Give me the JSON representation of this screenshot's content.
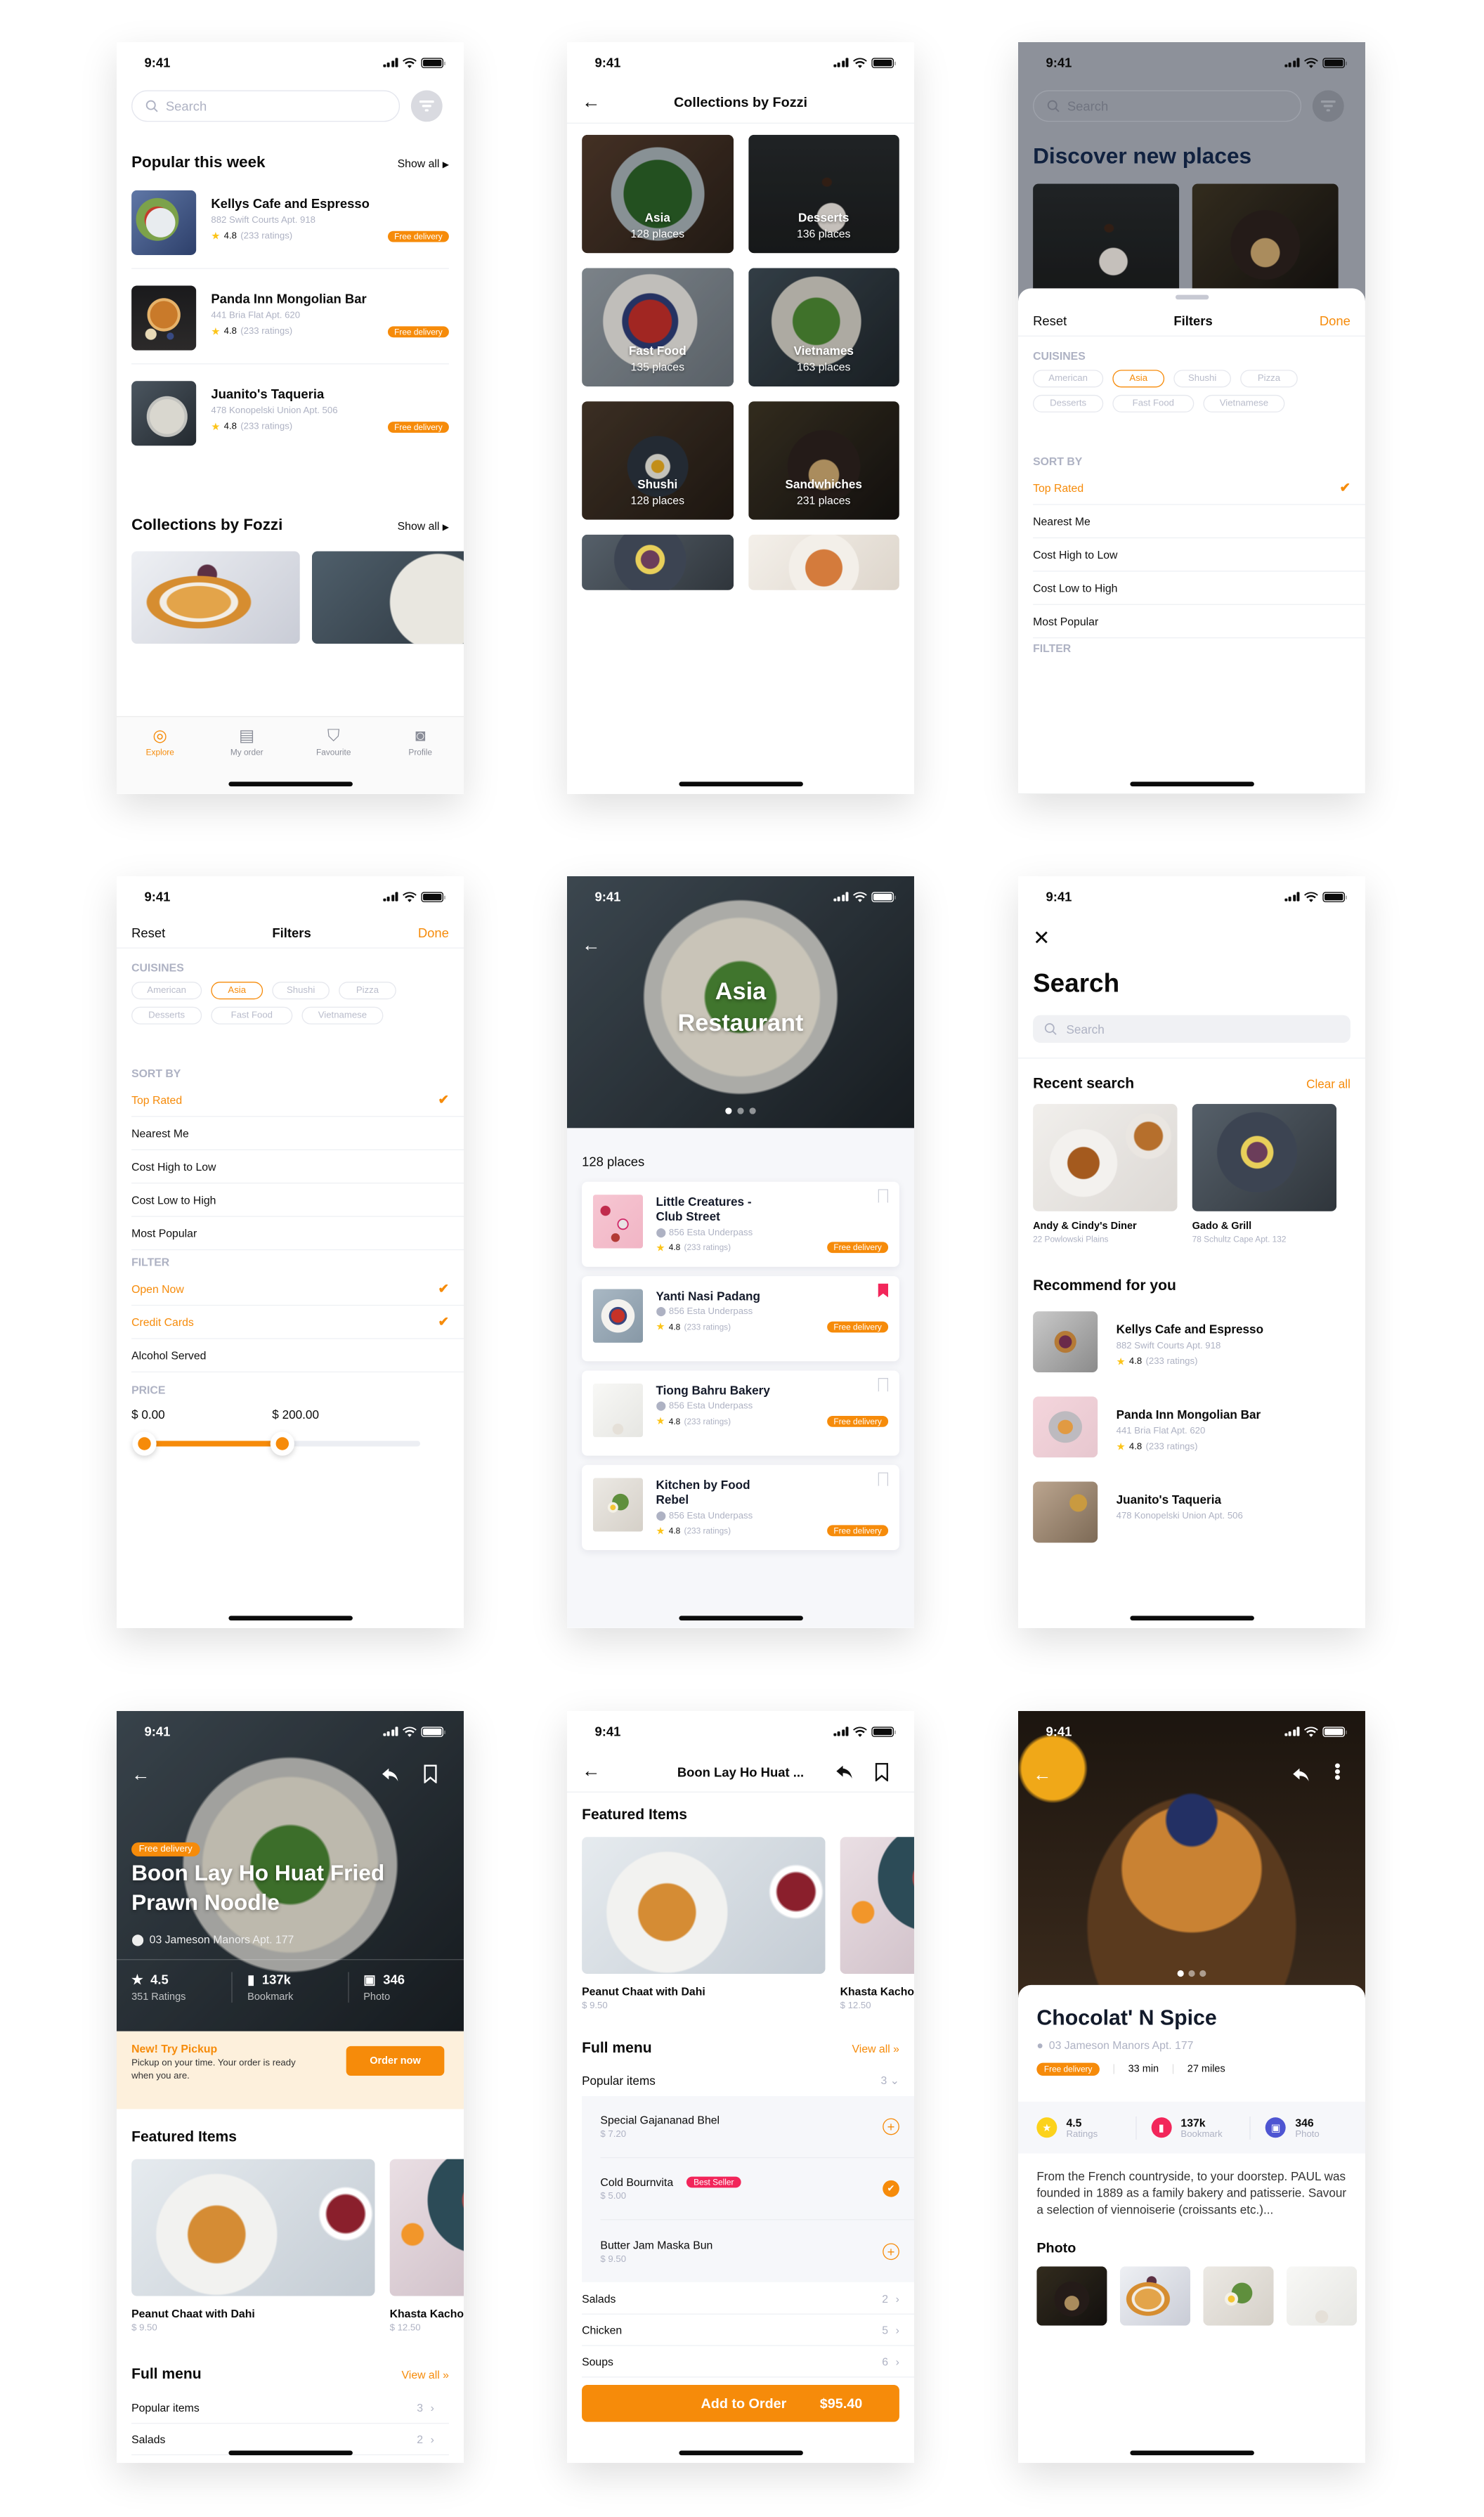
{
  "status_time": "9:41",
  "colors": {
    "accent": "#f68b0a",
    "text": "#0b0b0b",
    "muted": "#aeb2c3",
    "red": "#f2265a",
    "yellow": "#fcd21b",
    "indigo": "#4e55d2",
    "peach": "#fdf0dc"
  },
  "screen_home": {
    "search_placeholder": "Search",
    "popular_title": "Popular this week",
    "show_all": "Show all",
    "restaurants": [
      {
        "name": "Kellys Cafe and Espresso",
        "address": "882 Swift Courts Apt. 918",
        "rating": "4.8",
        "ratings_count": "(233 ratings)",
        "badge": "Free delivery"
      },
      {
        "name": "Panda Inn Mongolian Bar",
        "address": "441 Bria Flat Apt. 620",
        "rating": "4.8",
        "ratings_count": "(233 ratings)",
        "badge": "Free delivery"
      },
      {
        "name": "Juanito's Taqueria",
        "address": "478 Konopelski Union Apt. 506",
        "rating": "4.8",
        "ratings_count": "(233 ratings)",
        "badge": "Free delivery"
      }
    ],
    "collections_title": "Collections by Fozzi",
    "collections_show_all": "Show all",
    "tabs": [
      {
        "label": "Explore",
        "icon": "compass-icon",
        "active": true
      },
      {
        "label": "My order",
        "icon": "order-icon",
        "active": false
      },
      {
        "label": "Favourite",
        "icon": "bookmark-icon",
        "active": false
      },
      {
        "label": "Profile",
        "icon": "profile-icon",
        "active": false
      }
    ]
  },
  "screen_collections": {
    "title": "Collections by Fozzi",
    "items": [
      {
        "name": "Asia",
        "count": "128 places"
      },
      {
        "name": "Desserts",
        "count": "136 places"
      },
      {
        "name": "Fast Food",
        "count": "135 places"
      },
      {
        "name": "Vietnames",
        "count": "163 places"
      },
      {
        "name": "Shushi",
        "count": "128 places"
      },
      {
        "name": "Sandwhiches",
        "count": "231 places"
      }
    ]
  },
  "screen_filter_sheet": {
    "search_placeholder": "Search",
    "discover_title": "Discover new places",
    "reset": "Reset",
    "title": "Filters",
    "done": "Done",
    "cuisines_label": "CUISINES",
    "cuisines": [
      {
        "label": "American",
        "selected": false
      },
      {
        "label": "Asia",
        "selected": true
      },
      {
        "label": "Shushi",
        "selected": false
      },
      {
        "label": "Pizza",
        "selected": false
      },
      {
        "label": "Desserts",
        "selected": false
      },
      {
        "label": "Fast Food",
        "selected": false
      },
      {
        "label": "Vietnamese",
        "selected": false
      }
    ],
    "sort_label": "SORT BY",
    "sort_options": [
      {
        "label": "Top Rated",
        "selected": true
      },
      {
        "label": "Nearest Me",
        "selected": false
      },
      {
        "label": "Cost High to Low",
        "selected": false
      },
      {
        "label": "Cost Low to High",
        "selected": false
      },
      {
        "label": "Most Popular",
        "selected": false
      }
    ],
    "filter_label": "FILTER"
  },
  "screen_filters": {
    "reset": "Reset",
    "title": "Filters",
    "done": "Done",
    "cuisines_label": "CUISINES",
    "cuisines": [
      {
        "label": "American",
        "selected": false
      },
      {
        "label": "Asia",
        "selected": true
      },
      {
        "label": "Shushi",
        "selected": false
      },
      {
        "label": "Pizza",
        "selected": false
      },
      {
        "label": "Desserts",
        "selected": false
      },
      {
        "label": "Fast Food",
        "selected": false
      },
      {
        "label": "Vietnamese",
        "selected": false
      }
    ],
    "sort_label": "SORT BY",
    "sort_options": [
      {
        "label": "Top Rated",
        "selected": true
      },
      {
        "label": "Nearest Me",
        "selected": false
      },
      {
        "label": "Cost High to Low",
        "selected": false
      },
      {
        "label": "Cost Low to High",
        "selected": false
      },
      {
        "label": "Most Popular",
        "selected": false
      }
    ],
    "filter_label": "FILTER",
    "filter_options": [
      {
        "label": "Open Now",
        "selected": true
      },
      {
        "label": "Credit Cards",
        "selected": true
      },
      {
        "label": "Alcohol Served",
        "selected": false
      }
    ],
    "price_label": "PRICE",
    "price_min": "$ 0.00",
    "price_max": "$ 200.00",
    "price_range_fraction": [
      0,
      0.5
    ]
  },
  "screen_asia": {
    "hero_title_line1": "Asia",
    "hero_title_line2": "Restaurant",
    "carousel_pages": 3,
    "carousel_active": 1,
    "places_count": "128 places",
    "places": [
      {
        "name": "Little Creatures - Club Street",
        "address": "856 Esta Underpass",
        "rating": "4.8",
        "ratings_count": "(233 ratings)",
        "badge": "Free delivery",
        "bookmarked": false
      },
      {
        "name": "Yanti Nasi Padang",
        "address": "856 Esta Underpass",
        "rating": "4.8",
        "ratings_count": "(233 ratings)",
        "badge": "Free delivery",
        "bookmarked": true
      },
      {
        "name": "Tiong Bahru Bakery",
        "address": "856 Esta Underpass",
        "rating": "4.8",
        "ratings_count": "(233 ratings)",
        "badge": "Free delivery",
        "bookmarked": false
      },
      {
        "name": "Kitchen by Food Rebel",
        "address": "856 Esta Underpass",
        "rating": "4.8",
        "ratings_count": "(233 ratings)",
        "badge": "Free delivery",
        "bookmarked": false
      }
    ]
  },
  "screen_search": {
    "title": "Search",
    "search_placeholder": "Search",
    "recent_title": "Recent search",
    "clear_all": "Clear all",
    "recent": [
      {
        "name": "Andy & Cindy's Diner",
        "address": "22 Powlowski Plains"
      },
      {
        "name": "Gado & Grill",
        "address": "78 Schultz Cape Apt. 132"
      }
    ],
    "recommend_title": "Recommend for you",
    "recommend": [
      {
        "name": "Kellys Cafe and Espresso",
        "address": "882 Swift Courts Apt. 918",
        "rating": "4.8",
        "ratings_count": "(233 ratings)"
      },
      {
        "name": "Panda Inn Mongolian Bar",
        "address": "441 Bria Flat Apt. 620",
        "rating": "4.8",
        "ratings_count": "(233 ratings)"
      },
      {
        "name": "Juanito's Taqueria",
        "address": "478 Konopelski Union Apt. 506",
        "rating": "",
        "ratings_count": ""
      }
    ]
  },
  "screen_restaurant_hero": {
    "badge": "Free delivery",
    "title": "Boon Lay Ho Huat Fried Prawn Noodle",
    "address": "03 Jameson Manors Apt. 177",
    "stats": [
      {
        "value": "4.5",
        "label": "351 Ratings",
        "icon": "star-icon"
      },
      {
        "value": "137k",
        "label": "Bookmark",
        "icon": "bookmark-icon"
      },
      {
        "value": "346",
        "label": "Photo",
        "icon": "photo-icon"
      }
    ],
    "promo_title": "New! Try Pickup",
    "promo_text": "Pickup on your time. Your order is ready when you are.",
    "promo_button": "Order now",
    "featured_title": "Featured Items",
    "featured": [
      {
        "name": "Peanut Chaat with Dahi",
        "price": "$ 9.50"
      },
      {
        "name": "Khasta Kachori with",
        "price": "$ 12.50"
      }
    ],
    "menu_title": "Full menu",
    "view_all": "View all »",
    "menu": [
      {
        "label": "Popular items",
        "count": "3"
      },
      {
        "label": "Salads",
        "count": "2"
      }
    ]
  },
  "screen_menu": {
    "title": "Boon Lay Ho Huat ...",
    "featured_title": "Featured Items",
    "featured": [
      {
        "name": "Peanut Chaat with Dahi",
        "price": "$ 9.50"
      },
      {
        "name": "Khasta Kachori with",
        "price": "$ 12.50"
      }
    ],
    "menu_title": "Full menu",
    "view_all": "View all »",
    "popular_label": "Popular items",
    "popular_count": "3",
    "popular_items": [
      {
        "name": "Special Gajananad Bhel",
        "price": "$ 7.20",
        "added": false,
        "tag": ""
      },
      {
        "name": "Cold Bournvita",
        "price": "$ 5.00",
        "added": true,
        "tag": "Best Seller"
      },
      {
        "name": "Butter Jam Maska Bun",
        "price": "$ 9.50",
        "added": false,
        "tag": ""
      }
    ],
    "categories": [
      {
        "label": "Salads",
        "count": "2"
      },
      {
        "label": "Chicken",
        "count": "5"
      },
      {
        "label": "Soups",
        "count": "6"
      }
    ],
    "order_button": "Add to Order",
    "order_total": "$95.40"
  },
  "screen_detail": {
    "title": "Chocolat' N Spice",
    "address": "03 Jameson Manors Apt. 177",
    "badge": "Free delivery",
    "time": "33 min",
    "distance": "27 miles",
    "carousel_pages": 3,
    "carousel_active": 1,
    "stats": [
      {
        "value": "4.5",
        "label": "Ratings",
        "icon": "star-icon"
      },
      {
        "value": "137k",
        "label": "Bookmark",
        "icon": "bookmark-icon"
      },
      {
        "value": "346",
        "label": "Photo",
        "icon": "photo-icon"
      }
    ],
    "description": "From the French countryside, to your doorstep. PAUL was founded in 1889 as a family bakery and patisserie. Savour a selection of viennoiserie (croissants etc.)...",
    "photo_title": "Photo"
  }
}
